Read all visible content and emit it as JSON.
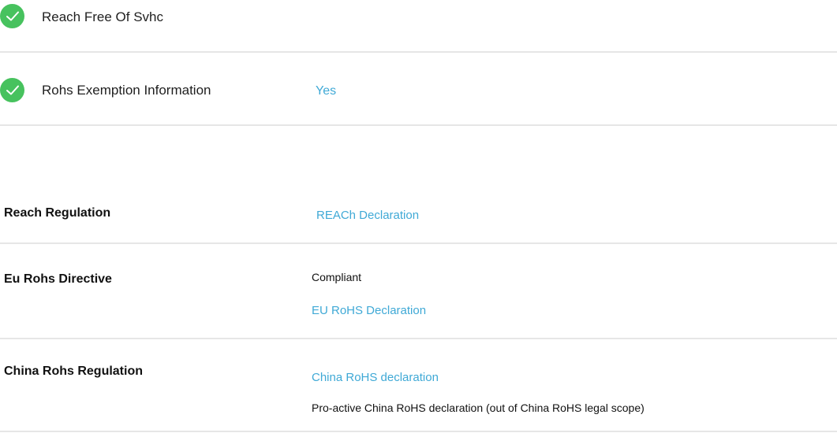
{
  "checks": [
    {
      "label": "Reach Free Of Svhc",
      "value": "",
      "icon": "check-circle-icon",
      "color": "#47c25e"
    },
    {
      "label": "Rohs Exemption Information",
      "value": "Yes",
      "icon": "check-circle-icon",
      "color": "#47c25e"
    }
  ],
  "regulations": {
    "reach": {
      "title": "Reach Regulation",
      "link": "REACh Declaration"
    },
    "eu_rohs": {
      "title": "Eu Rohs Directive",
      "status": "Compliant",
      "link": "EU RoHS Declaration"
    },
    "china_rohs": {
      "title": "China Rohs Regulation",
      "link": "China RoHS declaration",
      "note": "Pro-active China RoHS declaration (out of China RoHS legal scope)"
    }
  },
  "colors": {
    "accent_link": "#3fa9d6",
    "check_green": "#47c25e",
    "divider": "#e6e6e6"
  }
}
